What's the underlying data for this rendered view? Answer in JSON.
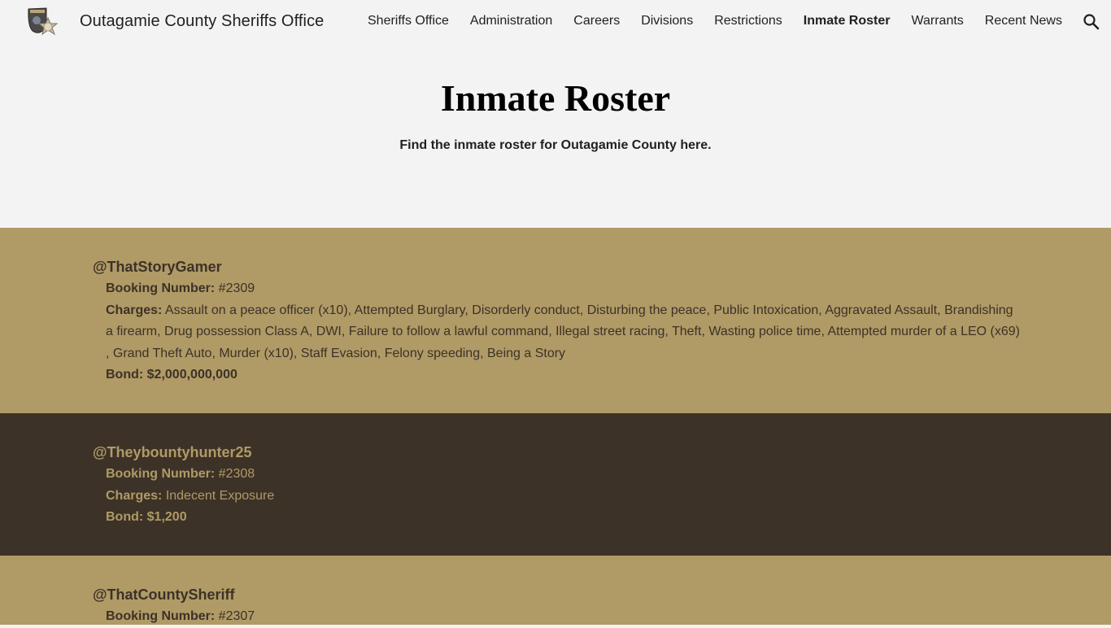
{
  "header": {
    "site_title": "Outagamie County Sheriffs Office",
    "logo_icon": "sheriff-badge-logo",
    "search_icon": "search-icon",
    "nav": [
      {
        "label": "Sheriffs Office",
        "active": false
      },
      {
        "label": "Administration",
        "active": false
      },
      {
        "label": "Careers",
        "active": false
      },
      {
        "label": "Divisions",
        "active": false
      },
      {
        "label": "Restrictions",
        "active": false
      },
      {
        "label": "Inmate Roster",
        "active": true
      },
      {
        "label": "Warrants",
        "active": false
      },
      {
        "label": "Recent News",
        "active": false
      }
    ]
  },
  "hero": {
    "title": "Inmate Roster",
    "subtitle": "Find the inmate roster for Outagamie County here."
  },
  "labels": {
    "booking": "Booking Number:",
    "charges": "Charges:",
    "bond": "Bond:"
  },
  "colors": {
    "tan": "#b09a66",
    "dark_brown": "#3d3227",
    "background": "#f3f3f3"
  },
  "inmates": [
    {
      "name": "@ThatStoryGamer",
      "booking_number": "#2309",
      "charges": "Assault on a peace officer (x10), Attempted Burglary, Disorderly conduct, Disturbing the peace, Public Intoxication, Aggravated Assault, Brandishing a firearm, Drug possession Class A, DWI, Failure to follow a lawful command, Illegal street racing, Theft, Wasting police time, Attempted murder of a LEO (x69) , Grand Theft Auto, Murder (x10), Staff Evasion, Felony speeding, Being a Story",
      "bond": "$2,000,000,000"
    },
    {
      "name": "@Theybountyhunter25",
      "booking_number": "#2308",
      "charges": "Indecent Exposure",
      "bond": "$1,200"
    },
    {
      "name": "@ThatCountySheriff",
      "booking_number": "#2307"
    }
  ]
}
